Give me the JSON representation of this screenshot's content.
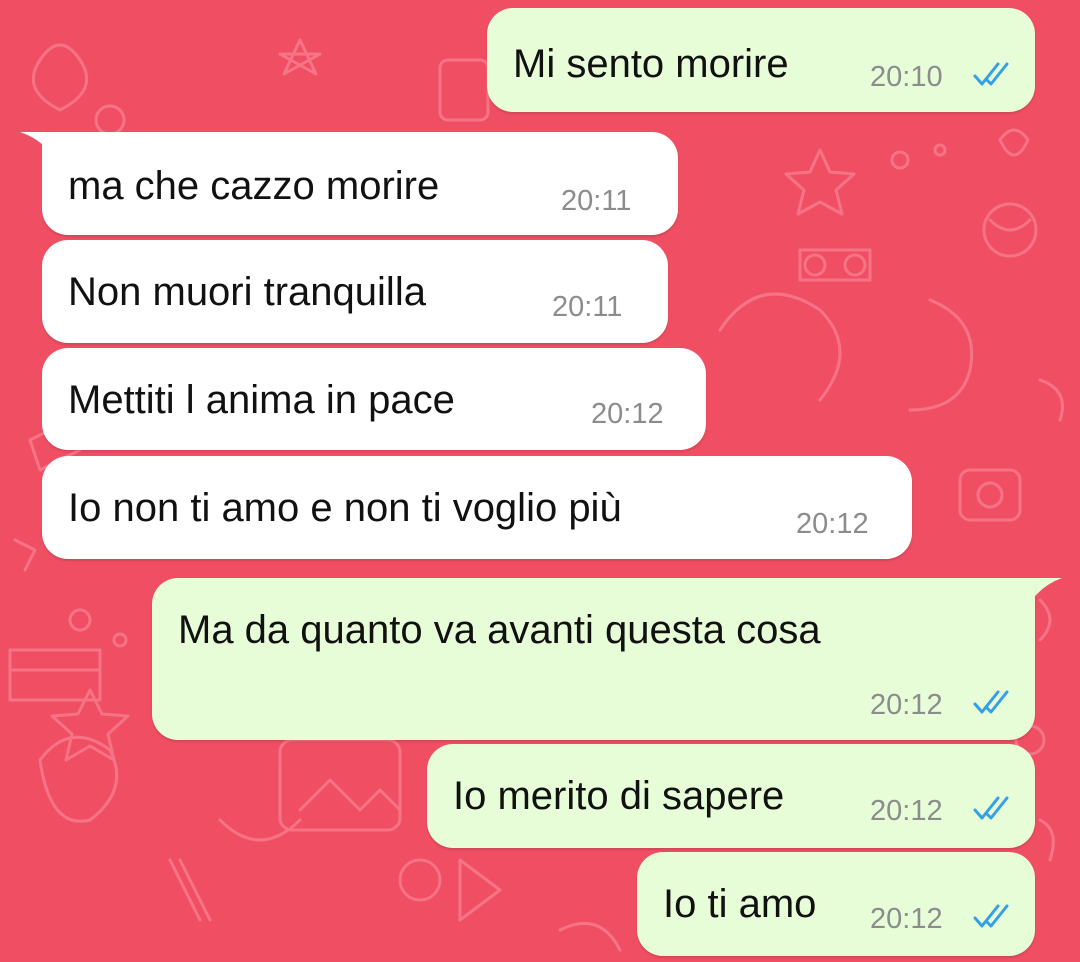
{
  "theme": {
    "background": "#f04f63",
    "incoming_bubble": "#ffffff",
    "outgoing_bubble": "#e7fdd8",
    "read_ticks": "#34a0e8"
  },
  "messages": [
    {
      "direction": "outgoing",
      "text": "Mi sento morire",
      "time": "20:10",
      "status": "read"
    },
    {
      "direction": "incoming",
      "text": "ma che cazzo morire",
      "time": "20:11"
    },
    {
      "direction": "incoming",
      "text": "Non muori tranquilla",
      "time": "20:11"
    },
    {
      "direction": "incoming",
      "text": "Mettiti l anima in pace",
      "time": "20:12"
    },
    {
      "direction": "incoming",
      "text": "Io non ti amo e non ti voglio più",
      "time": "20:12"
    },
    {
      "direction": "outgoing",
      "text": "Ma da quanto va avanti questa cosa",
      "time": "20:12",
      "status": "read"
    },
    {
      "direction": "outgoing",
      "text": "Io merito di sapere",
      "time": "20:12",
      "status": "read"
    },
    {
      "direction": "outgoing",
      "text": "Io ti amo",
      "time": "20:12",
      "status": "read"
    }
  ]
}
